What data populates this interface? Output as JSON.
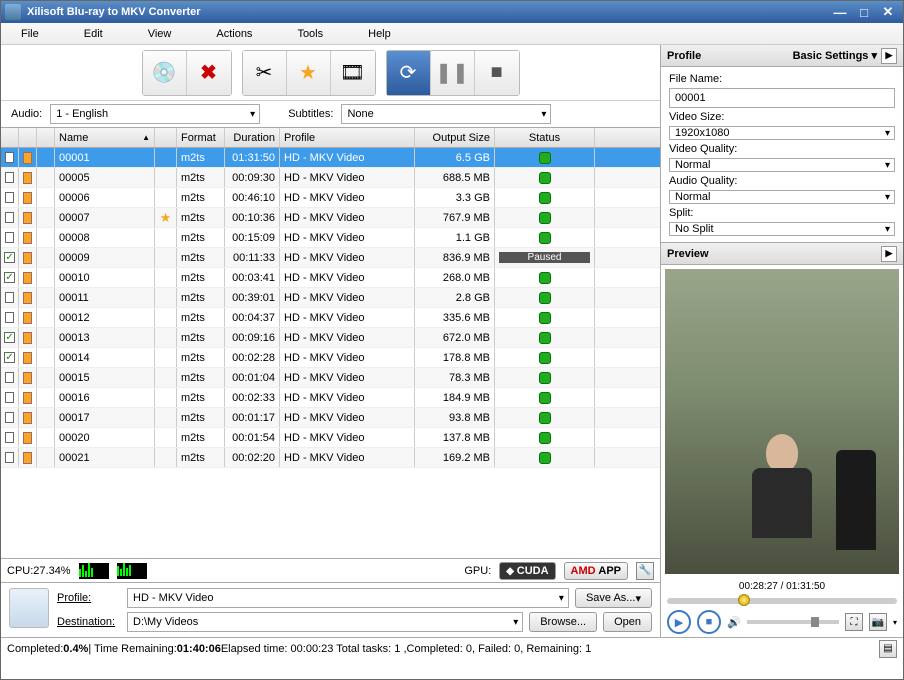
{
  "title": "Xilisoft Blu-ray to MKV Converter",
  "menu": [
    "File",
    "Edit",
    "View",
    "Actions",
    "Tools",
    "Help"
  ],
  "audioLabel": "Audio:",
  "audioValue": "1 - English",
  "subLabel": "Subtitles:",
  "subValue": "None",
  "cols": [
    "",
    "",
    "",
    "Name",
    "",
    "Format",
    "Duration",
    "Profile",
    "Output Size",
    "Status"
  ],
  "rows": [
    {
      "chk": false,
      "name": "00001",
      "star": false,
      "fmt": "m2ts",
      "dur": "01:31:50",
      "prof": "HD - MKV Video",
      "size": "6.5 GB",
      "status": "ok",
      "sel": true
    },
    {
      "chk": false,
      "name": "00005",
      "star": false,
      "fmt": "m2ts",
      "dur": "00:09:30",
      "prof": "HD - MKV Video",
      "size": "688.5 MB",
      "status": "ok"
    },
    {
      "chk": false,
      "name": "00006",
      "star": false,
      "fmt": "m2ts",
      "dur": "00:46:10",
      "prof": "HD - MKV Video",
      "size": "3.3 GB",
      "status": "ok"
    },
    {
      "chk": false,
      "name": "00007",
      "star": true,
      "fmt": "m2ts",
      "dur": "00:10:36",
      "prof": "HD - MKV Video",
      "size": "767.9 MB",
      "status": "ok"
    },
    {
      "chk": false,
      "name": "00008",
      "star": false,
      "fmt": "m2ts",
      "dur": "00:15:09",
      "prof": "HD - MKV Video",
      "size": "1.1 GB",
      "status": "ok"
    },
    {
      "chk": true,
      "name": "00009",
      "star": false,
      "fmt": "m2ts",
      "dur": "00:11:33",
      "prof": "HD - MKV Video",
      "size": "836.9 MB",
      "status": "paused"
    },
    {
      "chk": true,
      "name": "00010",
      "star": false,
      "fmt": "m2ts",
      "dur": "00:03:41",
      "prof": "HD - MKV Video",
      "size": "268.0 MB",
      "status": "ok"
    },
    {
      "chk": false,
      "name": "00011",
      "star": false,
      "fmt": "m2ts",
      "dur": "00:39:01",
      "prof": "HD - MKV Video",
      "size": "2.8 GB",
      "status": "ok"
    },
    {
      "chk": false,
      "name": "00012",
      "star": false,
      "fmt": "m2ts",
      "dur": "00:04:37",
      "prof": "HD - MKV Video",
      "size": "335.6 MB",
      "status": "ok"
    },
    {
      "chk": true,
      "name": "00013",
      "star": false,
      "fmt": "m2ts",
      "dur": "00:09:16",
      "prof": "HD - MKV Video",
      "size": "672.0 MB",
      "status": "ok"
    },
    {
      "chk": true,
      "name": "00014",
      "star": false,
      "fmt": "m2ts",
      "dur": "00:02:28",
      "prof": "HD - MKV Video",
      "size": "178.8 MB",
      "status": "ok"
    },
    {
      "chk": false,
      "name": "00015",
      "star": false,
      "fmt": "m2ts",
      "dur": "00:01:04",
      "prof": "HD - MKV Video",
      "size": "78.3 MB",
      "status": "ok"
    },
    {
      "chk": false,
      "name": "00016",
      "star": false,
      "fmt": "m2ts",
      "dur": "00:02:33",
      "prof": "HD - MKV Video",
      "size": "184.9 MB",
      "status": "ok"
    },
    {
      "chk": false,
      "name": "00017",
      "star": false,
      "fmt": "m2ts",
      "dur": "00:01:17",
      "prof": "HD - MKV Video",
      "size": "93.8 MB",
      "status": "ok"
    },
    {
      "chk": false,
      "name": "00020",
      "star": false,
      "fmt": "m2ts",
      "dur": "00:01:54",
      "prof": "HD - MKV Video",
      "size": "137.8 MB",
      "status": "ok"
    },
    {
      "chk": false,
      "name": "00021",
      "star": false,
      "fmt": "m2ts",
      "dur": "00:02:20",
      "prof": "HD - MKV Video",
      "size": "169.2 MB",
      "status": "ok"
    }
  ],
  "cpuLabel": "CPU:27.34%",
  "gpuLabel": "GPU:",
  "cuda": "CUDA",
  "amd": "AMD",
  "app": "APP",
  "profileLabel": "Profile:",
  "profileValue": "HD - MKV Video",
  "saveAs": "Save As...",
  "destLabel": "Destination:",
  "destValue": "D:\\My Videos",
  "browse": "Browse...",
  "open": "Open",
  "statusLine": {
    "a": "Completed: ",
    "pct": "0.4%",
    "b": " | Time Remaining: ",
    "rem": "01:40:06",
    "c": " Elapsed time: 00:00:23 Total tasks: 1 ,Completed: 0, Failed: 0, Remaining: 1"
  },
  "panel": {
    "title": "Profile",
    "mode": "Basic Settings",
    "fileNameL": "File Name:",
    "fileName": "00001",
    "videoSizeL": "Video Size:",
    "videoSize": "1920x1080",
    "videoQualL": "Video Quality:",
    "videoQual": "Normal",
    "audioQualL": "Audio Quality:",
    "audioQual": "Normal",
    "splitL": "Split:",
    "split": "No Split"
  },
  "preview": {
    "title": "Preview",
    "time": "00:28:27 / 01:31:50",
    "pos": 31
  },
  "pausedText": "Paused"
}
